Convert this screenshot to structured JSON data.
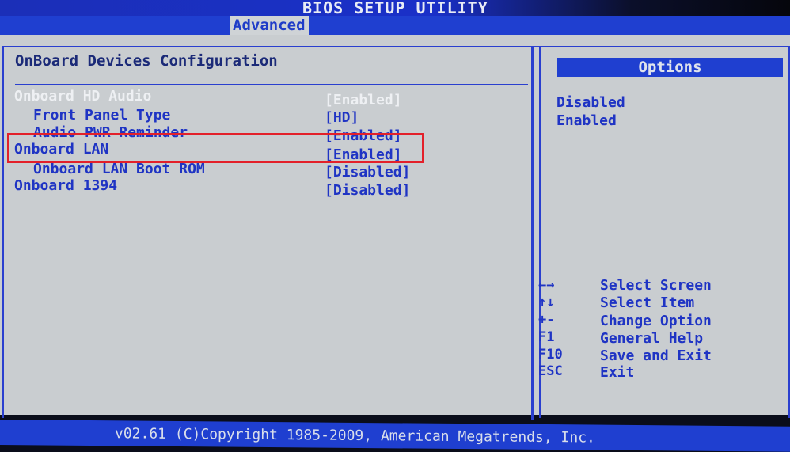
{
  "window": {
    "title": "BIOS SETUP UTILITY"
  },
  "tabs": [
    {
      "label": "Advanced",
      "active": true
    }
  ],
  "main": {
    "heading": "OnBoard Devices Configuration",
    "items": [
      {
        "label": "Onboard HD Audio",
        "value": "[Enabled]",
        "indent": false,
        "selected": true
      },
      {
        "label": "Front Panel Type",
        "value": "[HD]",
        "indent": true,
        "selected": false
      },
      {
        "label": "Audio PWR Reminder",
        "value": "[Enabled]",
        "indent": true,
        "selected": false
      },
      {
        "label": "Onboard LAN",
        "value": "[Enabled]",
        "indent": false,
        "selected": false,
        "highlighted": true
      },
      {
        "label": "Onboard LAN Boot ROM",
        "value": "[Disabled]",
        "indent": true,
        "selected": false
      },
      {
        "label": "Onboard 1394",
        "value": "[Disabled]",
        "indent": false,
        "selected": false
      }
    ]
  },
  "options": {
    "header": "Options",
    "values": [
      "Disabled",
      "Enabled"
    ]
  },
  "help": [
    {
      "key": "←→",
      "desc": "Select Screen",
      "icon": "left-right-arrows-icon"
    },
    {
      "key": "↑↓",
      "desc": "Select Item",
      "icon": "up-down-arrows-icon"
    },
    {
      "key": "+-",
      "desc": "Change Option",
      "icon": "plus-minus-icon"
    },
    {
      "key": "F1",
      "desc": "General Help"
    },
    {
      "key": "F10",
      "desc": "Save and Exit"
    },
    {
      "key": "ESC",
      "desc": "Exit"
    }
  ],
  "footer": {
    "text": "v02.61 (C)Copyright 1985-2009, American Megatrends, Inc."
  },
  "colors": {
    "accent": "#1f3fd0",
    "background": "#c9cdd0",
    "highlight_box": "#e3202a",
    "selected_text": "#eef0f3"
  }
}
